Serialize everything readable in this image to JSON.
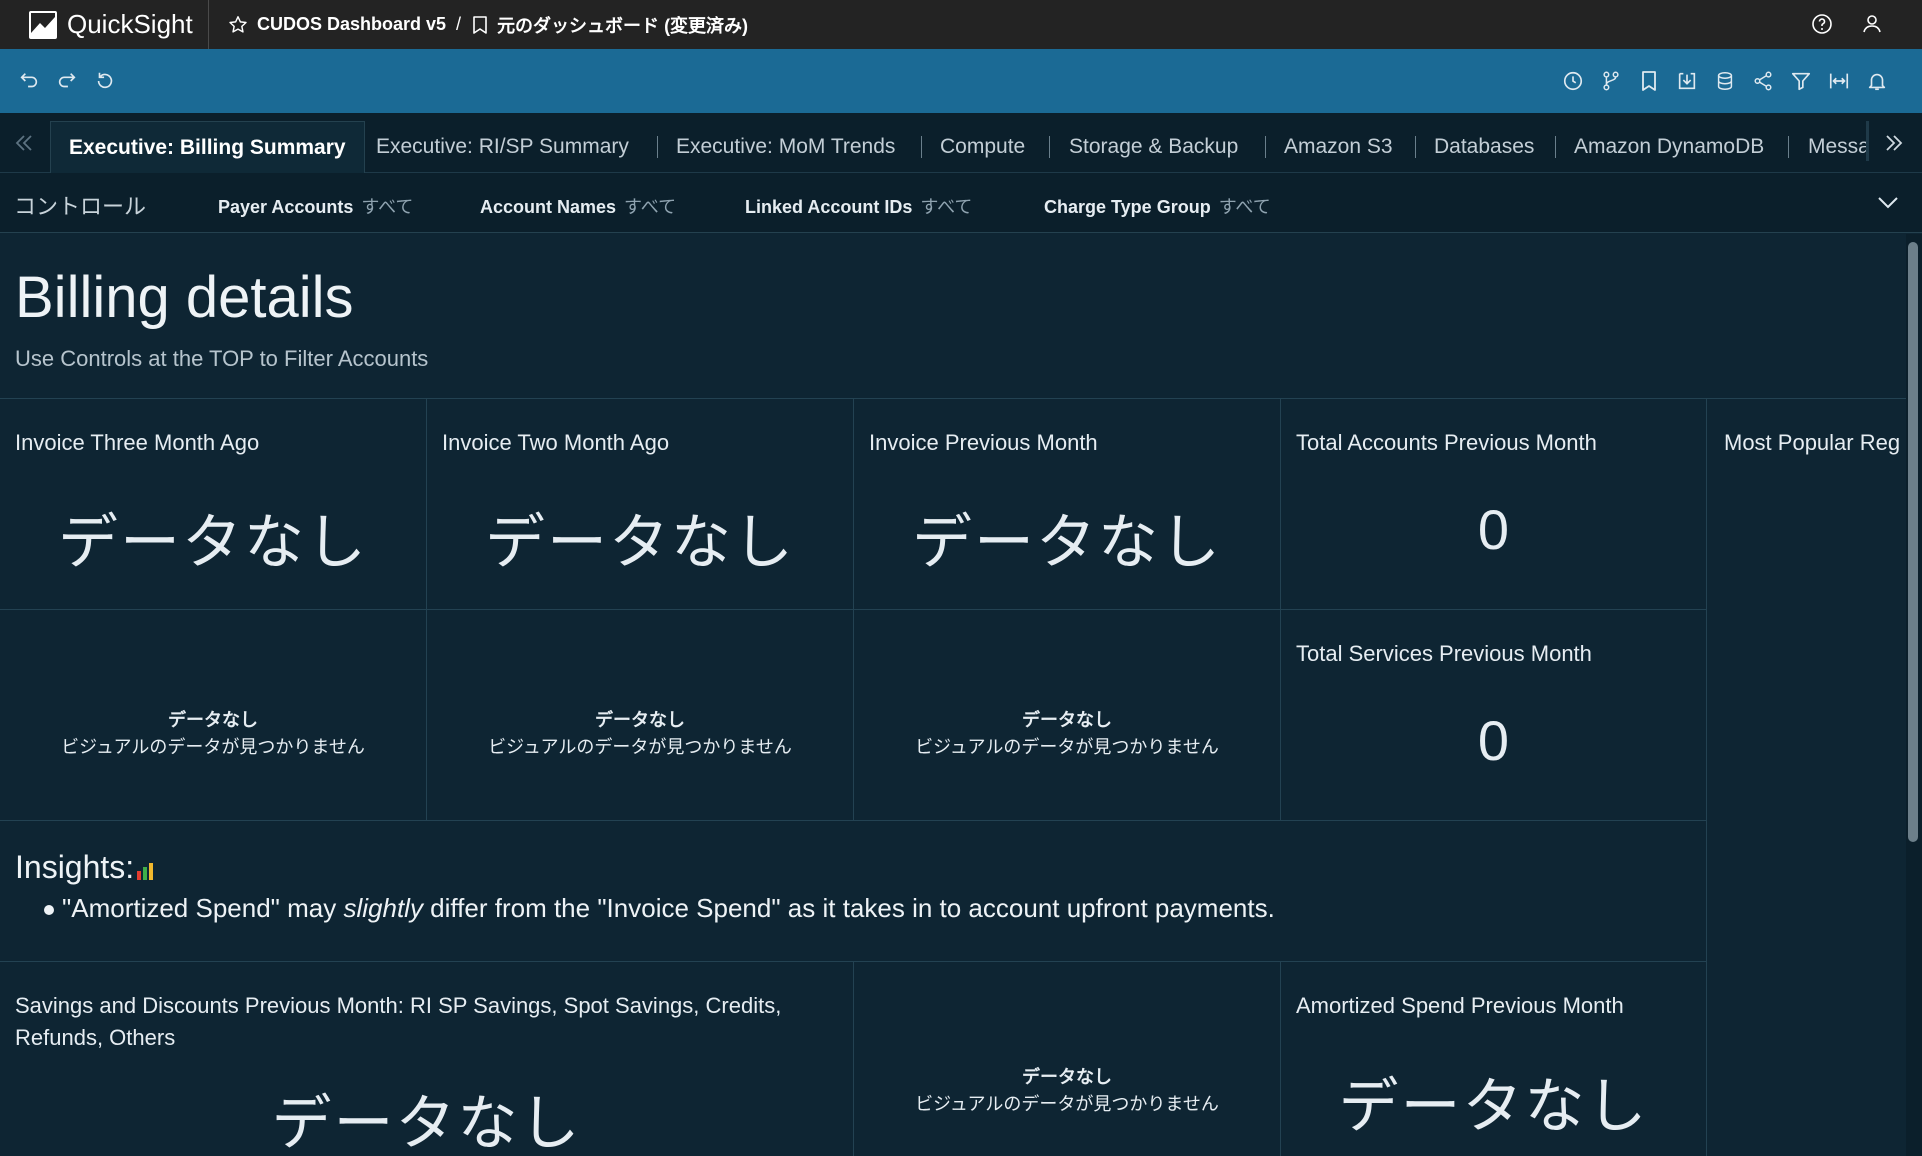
{
  "app": {
    "name": "QuickSight"
  },
  "breadcrumb": {
    "dashboard": "CUDOS Dashboard v5",
    "separator": "/",
    "sheet": "元のダッシュボード (変更済み)"
  },
  "tabs": [
    "Executive: Billing Summary",
    "Executive: RI/SP Summary",
    "Executive: MoM Trends",
    "Compute",
    "Storage & Backup",
    "Amazon S3",
    "Databases",
    "Amazon DynamoDB",
    "Messa"
  ],
  "controls": {
    "title": "コントロール",
    "items": [
      {
        "label": "Payer Accounts",
        "value": "すべて"
      },
      {
        "label": "Account Names",
        "value": "すべて"
      },
      {
        "label": "Linked Account IDs",
        "value": "すべて"
      },
      {
        "label": "Charge Type Group",
        "value": "すべて"
      }
    ]
  },
  "header": {
    "title": "Billing details",
    "subtitle": "Use Controls at the TOP to Filter Accounts"
  },
  "kpis": {
    "invoice_three": {
      "title": "Invoice Three Month Ago",
      "value": "データなし"
    },
    "invoice_two": {
      "title": "Invoice Two Month Ago",
      "value": "データなし"
    },
    "invoice_prev": {
      "title": "Invoice Previous Month",
      "value": "データなし"
    },
    "total_accounts": {
      "title": "Total Accounts Previous Month",
      "value": "0"
    },
    "total_services": {
      "title": "Total Services Previous Month",
      "value": "0"
    },
    "most_popular": {
      "title": "Most Popular Reg"
    },
    "savings": {
      "title": "Savings and Discounts Previous Month: RI SP Savings, Spot Savings, Credits, Refunds, Others",
      "value": "データなし"
    },
    "amortized": {
      "title": "Amortized Spend Previous Month",
      "value": "データなし"
    }
  },
  "nodata": {
    "title": "データなし",
    "message": "ビジュアルのデータが見つかりません"
  },
  "insights": {
    "title": "Insights:",
    "part1": "\"Amortized Spend\" may ",
    "emphasis": "slightly",
    "part2": " differ from the \"Invoice Spend\" as it takes in to account upfront payments."
  }
}
